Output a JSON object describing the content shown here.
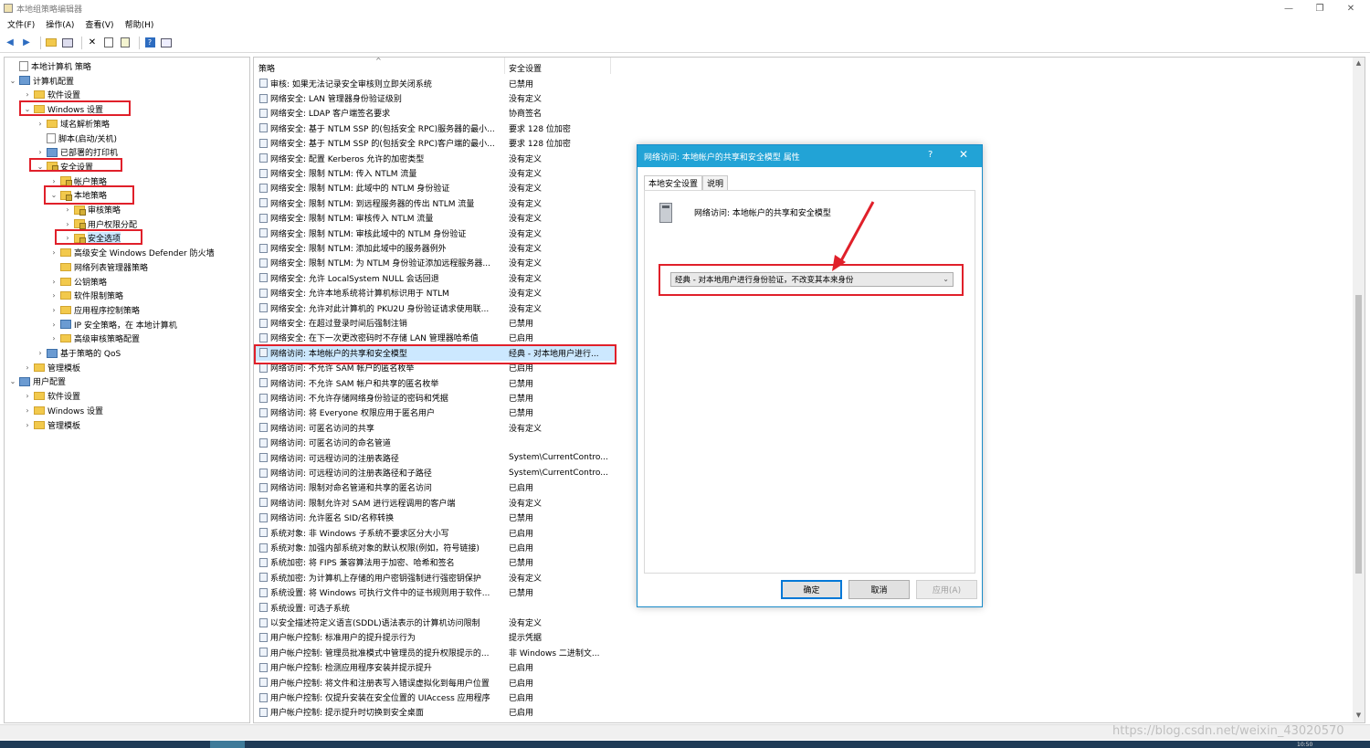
{
  "window": {
    "title": "本地组策略编辑器",
    "controls": {
      "minimize": "—",
      "maximize": "❐",
      "close": "✕"
    }
  },
  "menu": [
    "文件(F)",
    "操作(A)",
    "查看(V)",
    "帮助(H)"
  ],
  "tree": [
    {
      "label": "本地计算机 策略",
      "level": 0,
      "icon": "doc",
      "chev": ""
    },
    {
      "label": "计算机配置",
      "level": 1,
      "icon": "pc",
      "chev": "⌄"
    },
    {
      "label": "软件设置",
      "level": 2,
      "icon": "folder",
      "chev": "›"
    },
    {
      "label": "Windows 设置",
      "level": 2,
      "icon": "folder",
      "chev": "⌄"
    },
    {
      "label": "域名解析策略",
      "level": 3,
      "icon": "folder",
      "chev": "›"
    },
    {
      "label": "脚本(启动/关机)",
      "level": 3,
      "icon": "doc",
      "chev": ""
    },
    {
      "label": "已部署的打印机",
      "level": 3,
      "icon": "pc",
      "chev": "›"
    },
    {
      "label": "安全设置",
      "level": 3,
      "icon": "lock",
      "chev": "⌄"
    },
    {
      "label": "帐户策略",
      "level": 4,
      "icon": "lock",
      "chev": "›"
    },
    {
      "label": "本地策略",
      "level": 4,
      "icon": "lock",
      "chev": "⌄"
    },
    {
      "label": "审核策略",
      "level": 5,
      "icon": "lock",
      "chev": "›"
    },
    {
      "label": "用户权限分配",
      "level": 5,
      "icon": "lock",
      "chev": "›"
    },
    {
      "label": "安全选项",
      "level": 5,
      "icon": "lock",
      "chev": "›",
      "selected": true
    },
    {
      "label": "高级安全 Windows Defender 防火墙",
      "level": 4,
      "icon": "folder",
      "chev": "›"
    },
    {
      "label": "网络列表管理器策略",
      "level": 4,
      "icon": "folder",
      "chev": ""
    },
    {
      "label": "公钥策略",
      "level": 4,
      "icon": "folder",
      "chev": "›"
    },
    {
      "label": "软件限制策略",
      "level": 4,
      "icon": "folder",
      "chev": "›"
    },
    {
      "label": "应用程序控制策略",
      "level": 4,
      "icon": "folder",
      "chev": "›"
    },
    {
      "label": "IP 安全策略，在 本地计算机",
      "level": 4,
      "icon": "pc",
      "chev": "›"
    },
    {
      "label": "高级审核策略配置",
      "level": 4,
      "icon": "folder",
      "chev": "›"
    },
    {
      "label": "基于策略的 QoS",
      "level": 3,
      "icon": "pc",
      "chev": "›"
    },
    {
      "label": "管理模板",
      "level": 2,
      "icon": "folder",
      "chev": "›"
    },
    {
      "label": "用户配置",
      "level": 1,
      "icon": "pc",
      "chev": "⌄"
    },
    {
      "label": "软件设置",
      "level": 2,
      "icon": "folder",
      "chev": "›"
    },
    {
      "label": "Windows 设置",
      "level": 2,
      "icon": "folder",
      "chev": "›"
    },
    {
      "label": "管理模板",
      "level": 2,
      "icon": "folder",
      "chev": "›"
    }
  ],
  "columns": {
    "policy": "策略",
    "setting": "安全设置"
  },
  "policies": [
    [
      "审核: 如果无法记录安全审核则立即关闭系统",
      "已禁用"
    ],
    [
      "网络安全: LAN 管理器身份验证级别",
      "没有定义"
    ],
    [
      "网络安全: LDAP 客户端签名要求",
      "协商签名"
    ],
    [
      "网络安全: 基于 NTLM SSP 的(包括安全 RPC)服务器的最小...",
      "要求 128 位加密"
    ],
    [
      "网络安全: 基于 NTLM SSP 的(包括安全 RPC)客户端的最小...",
      "要求 128 位加密"
    ],
    [
      "网络安全: 配置 Kerberos 允许的加密类型",
      "没有定义"
    ],
    [
      "网络安全: 限制 NTLM: 传入 NTLM 流量",
      "没有定义"
    ],
    [
      "网络安全: 限制 NTLM: 此域中的 NTLM 身份验证",
      "没有定义"
    ],
    [
      "网络安全: 限制 NTLM: 到远程服务器的传出 NTLM 流量",
      "没有定义"
    ],
    [
      "网络安全: 限制 NTLM: 审核传入 NTLM 流量",
      "没有定义"
    ],
    [
      "网络安全: 限制 NTLM: 审核此域中的 NTLM 身份验证",
      "没有定义"
    ],
    [
      "网络安全: 限制 NTLM: 添加此域中的服务器例外",
      "没有定义"
    ],
    [
      "网络安全: 限制 NTLM: 为 NTLM 身份验证添加远程服务器...",
      "没有定义"
    ],
    [
      "网络安全: 允许 LocalSystem NULL 会话回退",
      "没有定义"
    ],
    [
      "网络安全: 允许本地系统将计算机标识用于 NTLM",
      "没有定义"
    ],
    [
      "网络安全: 允许对此计算机的 PKU2U 身份验证请求使用联...",
      "没有定义"
    ],
    [
      "网络安全: 在超过登录时间后强制注销",
      "已禁用"
    ],
    [
      "网络安全: 在下一次更改密码时不存储 LAN 管理器哈希值",
      "已启用"
    ],
    [
      "网络访问: 本地帐户的共享和安全模型",
      "经典 - 对本地用户进行..."
    ],
    [
      "网络访问: 不允许 SAM 帐户的匿名枚举",
      "已启用"
    ],
    [
      "网络访问: 不允许 SAM 帐户和共享的匿名枚举",
      "已禁用"
    ],
    [
      "网络访问: 不允许存储网络身份验证的密码和凭据",
      "已禁用"
    ],
    [
      "网络访问: 将 Everyone 权限应用于匿名用户",
      "已禁用"
    ],
    [
      "网络访问: 可匿名访问的共享",
      "没有定义"
    ],
    [
      "网络访问: 可匿名访问的命名管道",
      ""
    ],
    [
      "网络访问: 可远程访问的注册表路径",
      "System\\CurrentContro..."
    ],
    [
      "网络访问: 可远程访问的注册表路径和子路径",
      "System\\CurrentContro..."
    ],
    [
      "网络访问: 限制对命名管道和共享的匿名访问",
      "已启用"
    ],
    [
      "网络访问: 限制允许对 SAM 进行远程调用的客户端",
      "没有定义"
    ],
    [
      "网络访问: 允许匿名 SID/名称转换",
      "已禁用"
    ],
    [
      "系统对象: 非 Windows 子系统不要求区分大小写",
      "已启用"
    ],
    [
      "系统对象: 加强内部系统对象的默认权限(例如，符号链接)",
      "已启用"
    ],
    [
      "系统加密: 将 FIPS 兼容算法用于加密、哈希和签名",
      "已禁用"
    ],
    [
      "系统加密: 为计算机上存储的用户密钥强制进行强密钥保护",
      "没有定义"
    ],
    [
      "系统设置: 将 Windows 可执行文件中的证书规则用于软件...",
      "已禁用"
    ],
    [
      "系统设置: 可选子系统",
      ""
    ],
    [
      "以安全描述符定义语言(SDDL)语法表示的计算机访问限制",
      "没有定义"
    ],
    [
      "用户帐户控制: 标准用户的提升提示行为",
      "提示凭据"
    ],
    [
      "用户帐户控制: 管理员批准模式中管理员的提升权限提示的...",
      "非 Windows 二进制文..."
    ],
    [
      "用户帐户控制: 检测应用程序安装并提示提升",
      "已启用"
    ],
    [
      "用户帐户控制: 将文件和注册表写入错误虚拟化到每用户位置",
      "已启用"
    ],
    [
      "用户帐户控制: 仅提升安装在安全位置的 UIAccess 应用程序",
      "已启用"
    ],
    [
      "用户帐户控制: 提示提升时切换到安全桌面",
      "已启用"
    ]
  ],
  "selected_policy_index": 18,
  "dialog": {
    "title": "网络访问: 本地帐户的共享和安全模型 属性",
    "help": "?",
    "close": "✕",
    "tabs": [
      "本地安全设置",
      "说明"
    ],
    "description": "网络访问: 本地帐户的共享和安全模型",
    "select_value": "经典 - 对本地用户进行身份验证，不改变其本来身份",
    "buttons": {
      "ok": "确定",
      "cancel": "取消",
      "apply": "应用(A)"
    }
  },
  "watermark": "https://blog.csdn.net/weixin_43020570",
  "clock": "10:50",
  "colors": {
    "accent": "#22a3d6",
    "highlight": "#e0202a",
    "selection": "#cce8ff"
  }
}
